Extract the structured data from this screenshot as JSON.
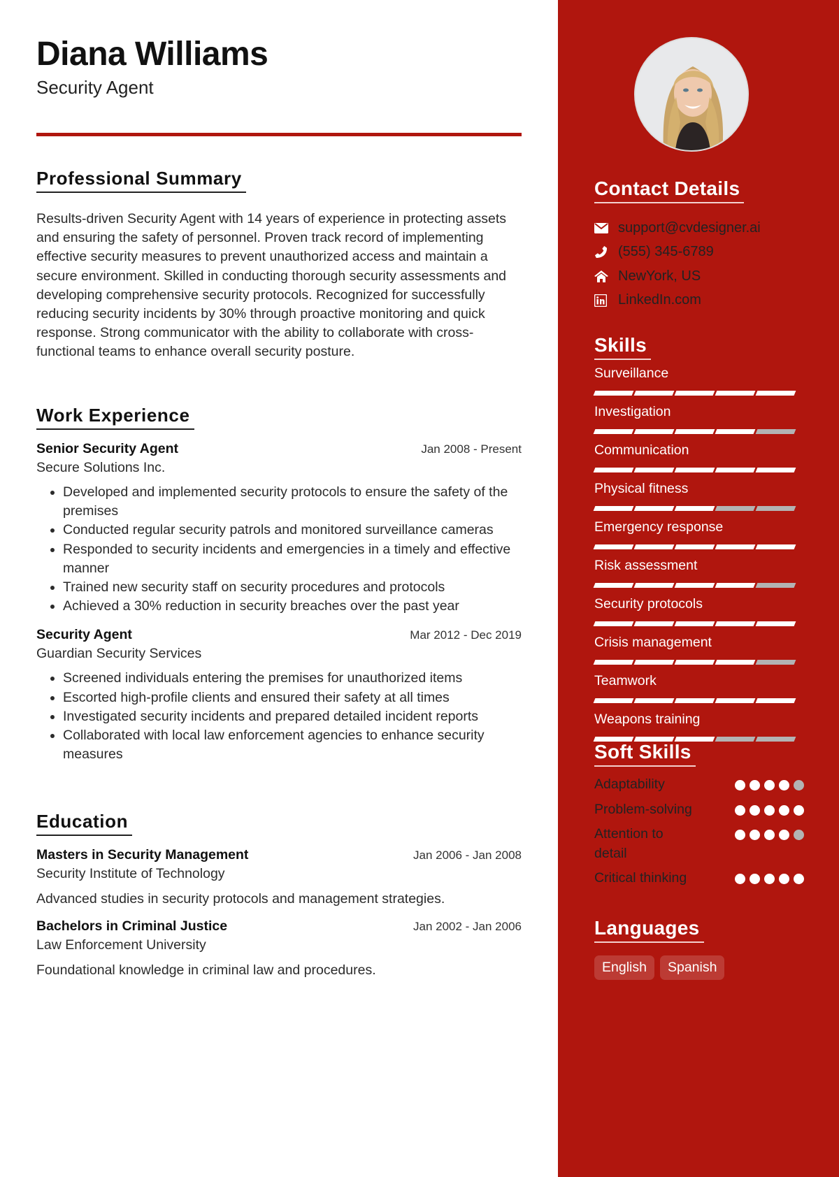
{
  "header": {
    "name": "Diana Williams",
    "title": "Security Agent",
    "accent_color": "#B0160E"
  },
  "summary": {
    "heading": "Professional Summary",
    "text": "Results-driven Security Agent with 14 years of experience in protecting assets and ensuring the safety of personnel. Proven track record of implementing effective security measures to prevent unauthorized access and maintain a secure environment. Skilled in conducting thorough security assessments and developing comprehensive security protocols. Recognized for successfully reducing security incidents by 30% through proactive monitoring and quick response. Strong communicator with the ability to collaborate with cross-functional teams to enhance overall security posture."
  },
  "work": {
    "heading": "Work Experience",
    "items": [
      {
        "role": "Senior Security Agent",
        "date": "Jan 2008 - Present",
        "org": "Secure Solutions Inc.",
        "bullets": [
          "Developed and implemented security protocols to ensure the safety of the premises",
          "Conducted regular security patrols and monitored surveillance cameras",
          "Responded to security incidents and emergencies in a timely and effective manner",
          "Trained new security staff on security procedures and protocols",
          "Achieved a 30% reduction in security breaches over the past year"
        ]
      },
      {
        "role": "Security Agent",
        "date": "Mar 2012 - Dec 2019",
        "org": "Guardian Security Services",
        "bullets": [
          "Screened individuals entering the premises for unauthorized items",
          "Escorted high-profile clients and ensured their safety at all times",
          "Investigated security incidents and prepared detailed incident reports",
          "Collaborated with local law enforcement agencies to enhance security measures"
        ]
      }
    ]
  },
  "education": {
    "heading": "Education",
    "items": [
      {
        "degree": "Masters in Security Management",
        "date": "Jan 2006 - Jan 2008",
        "school": "Security Institute of Technology",
        "desc": "Advanced studies in security protocols and management strategies."
      },
      {
        "degree": "Bachelors in Criminal Justice",
        "date": "Jan 2002 - Jan 2006",
        "school": "Law Enforcement University",
        "desc": "Foundational knowledge in criminal law and procedures."
      }
    ]
  },
  "sidebar": {
    "photo_alt": "Profile photo",
    "contact": {
      "heading": "Contact Details",
      "items": [
        {
          "icon": "envelope-icon",
          "text": "support@cvdesigner.ai"
        },
        {
          "icon": "phone-icon",
          "text": "(555) 345-6789"
        },
        {
          "icon": "home-icon",
          "text": "NewYork, US"
        },
        {
          "icon": "linkedin-icon",
          "text": "LinkedIn.com"
        }
      ]
    },
    "skills": {
      "heading": "Skills",
      "max": 5,
      "items": [
        {
          "label": "Surveillance",
          "level": 5
        },
        {
          "label": "Investigation",
          "level": 4
        },
        {
          "label": "Communication",
          "level": 5
        },
        {
          "label": "Physical fitness",
          "level": 3
        },
        {
          "label": "Emergency response",
          "level": 5
        },
        {
          "label": "Risk assessment",
          "level": 4
        },
        {
          "label": "Security protocols",
          "level": 5
        },
        {
          "label": "Crisis management",
          "level": 4
        },
        {
          "label": "Teamwork",
          "level": 5
        },
        {
          "label": "Weapons training",
          "level": 3
        }
      ]
    },
    "soft_skills": {
      "heading": "Soft Skills",
      "max": 5,
      "items": [
        {
          "label": "Adaptability",
          "level": 4
        },
        {
          "label": "Problem-solving",
          "level": 5
        },
        {
          "label": "Attention to detail",
          "level": 4
        },
        {
          "label": "Critical thinking",
          "level": 5
        }
      ]
    },
    "languages": {
      "heading": "Languages",
      "items": [
        "English",
        "Spanish"
      ]
    }
  }
}
